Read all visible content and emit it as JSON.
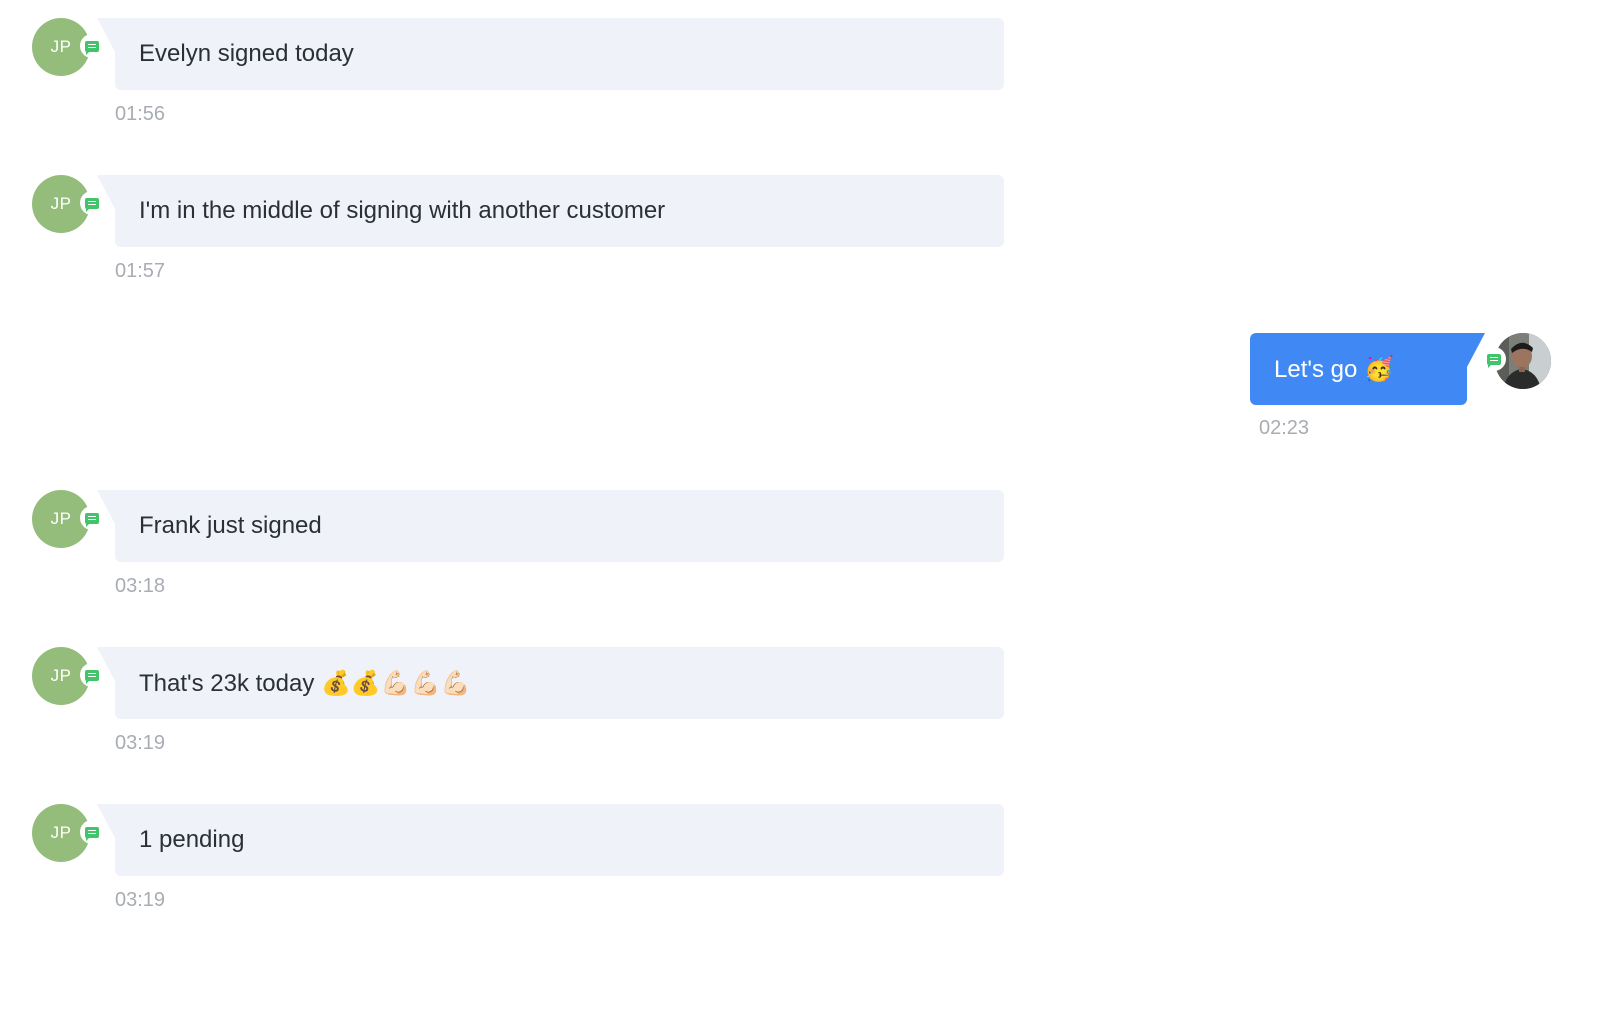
{
  "colors": {
    "incoming_bubble": "#eff2f9",
    "outgoing_bubble": "#4089f4",
    "avatar_green": "#94bd7c",
    "channel_badge": "#42c46b",
    "timestamp": "#a8acb3"
  },
  "messages": [
    {
      "direction": "incoming",
      "avatar_initials": "JP",
      "text": "Evelyn signed today",
      "time": "01:56"
    },
    {
      "direction": "incoming",
      "avatar_initials": "JP",
      "text": "I'm in the middle of signing with another customer",
      "time": "01:57"
    },
    {
      "direction": "outgoing",
      "text": "Let's go 🥳",
      "time": "02:23"
    },
    {
      "direction": "incoming",
      "avatar_initials": "JP",
      "text": "Frank just signed",
      "time": "03:18"
    },
    {
      "direction": "incoming",
      "avatar_initials": "JP",
      "text": "That's 23k today 💰💰💪🏻💪🏻💪🏻",
      "time": "03:19"
    },
    {
      "direction": "incoming",
      "avatar_initials": "JP",
      "text": "1 pending",
      "time": "03:19"
    }
  ],
  "icons": {
    "channel_badge": "chat-icon"
  }
}
